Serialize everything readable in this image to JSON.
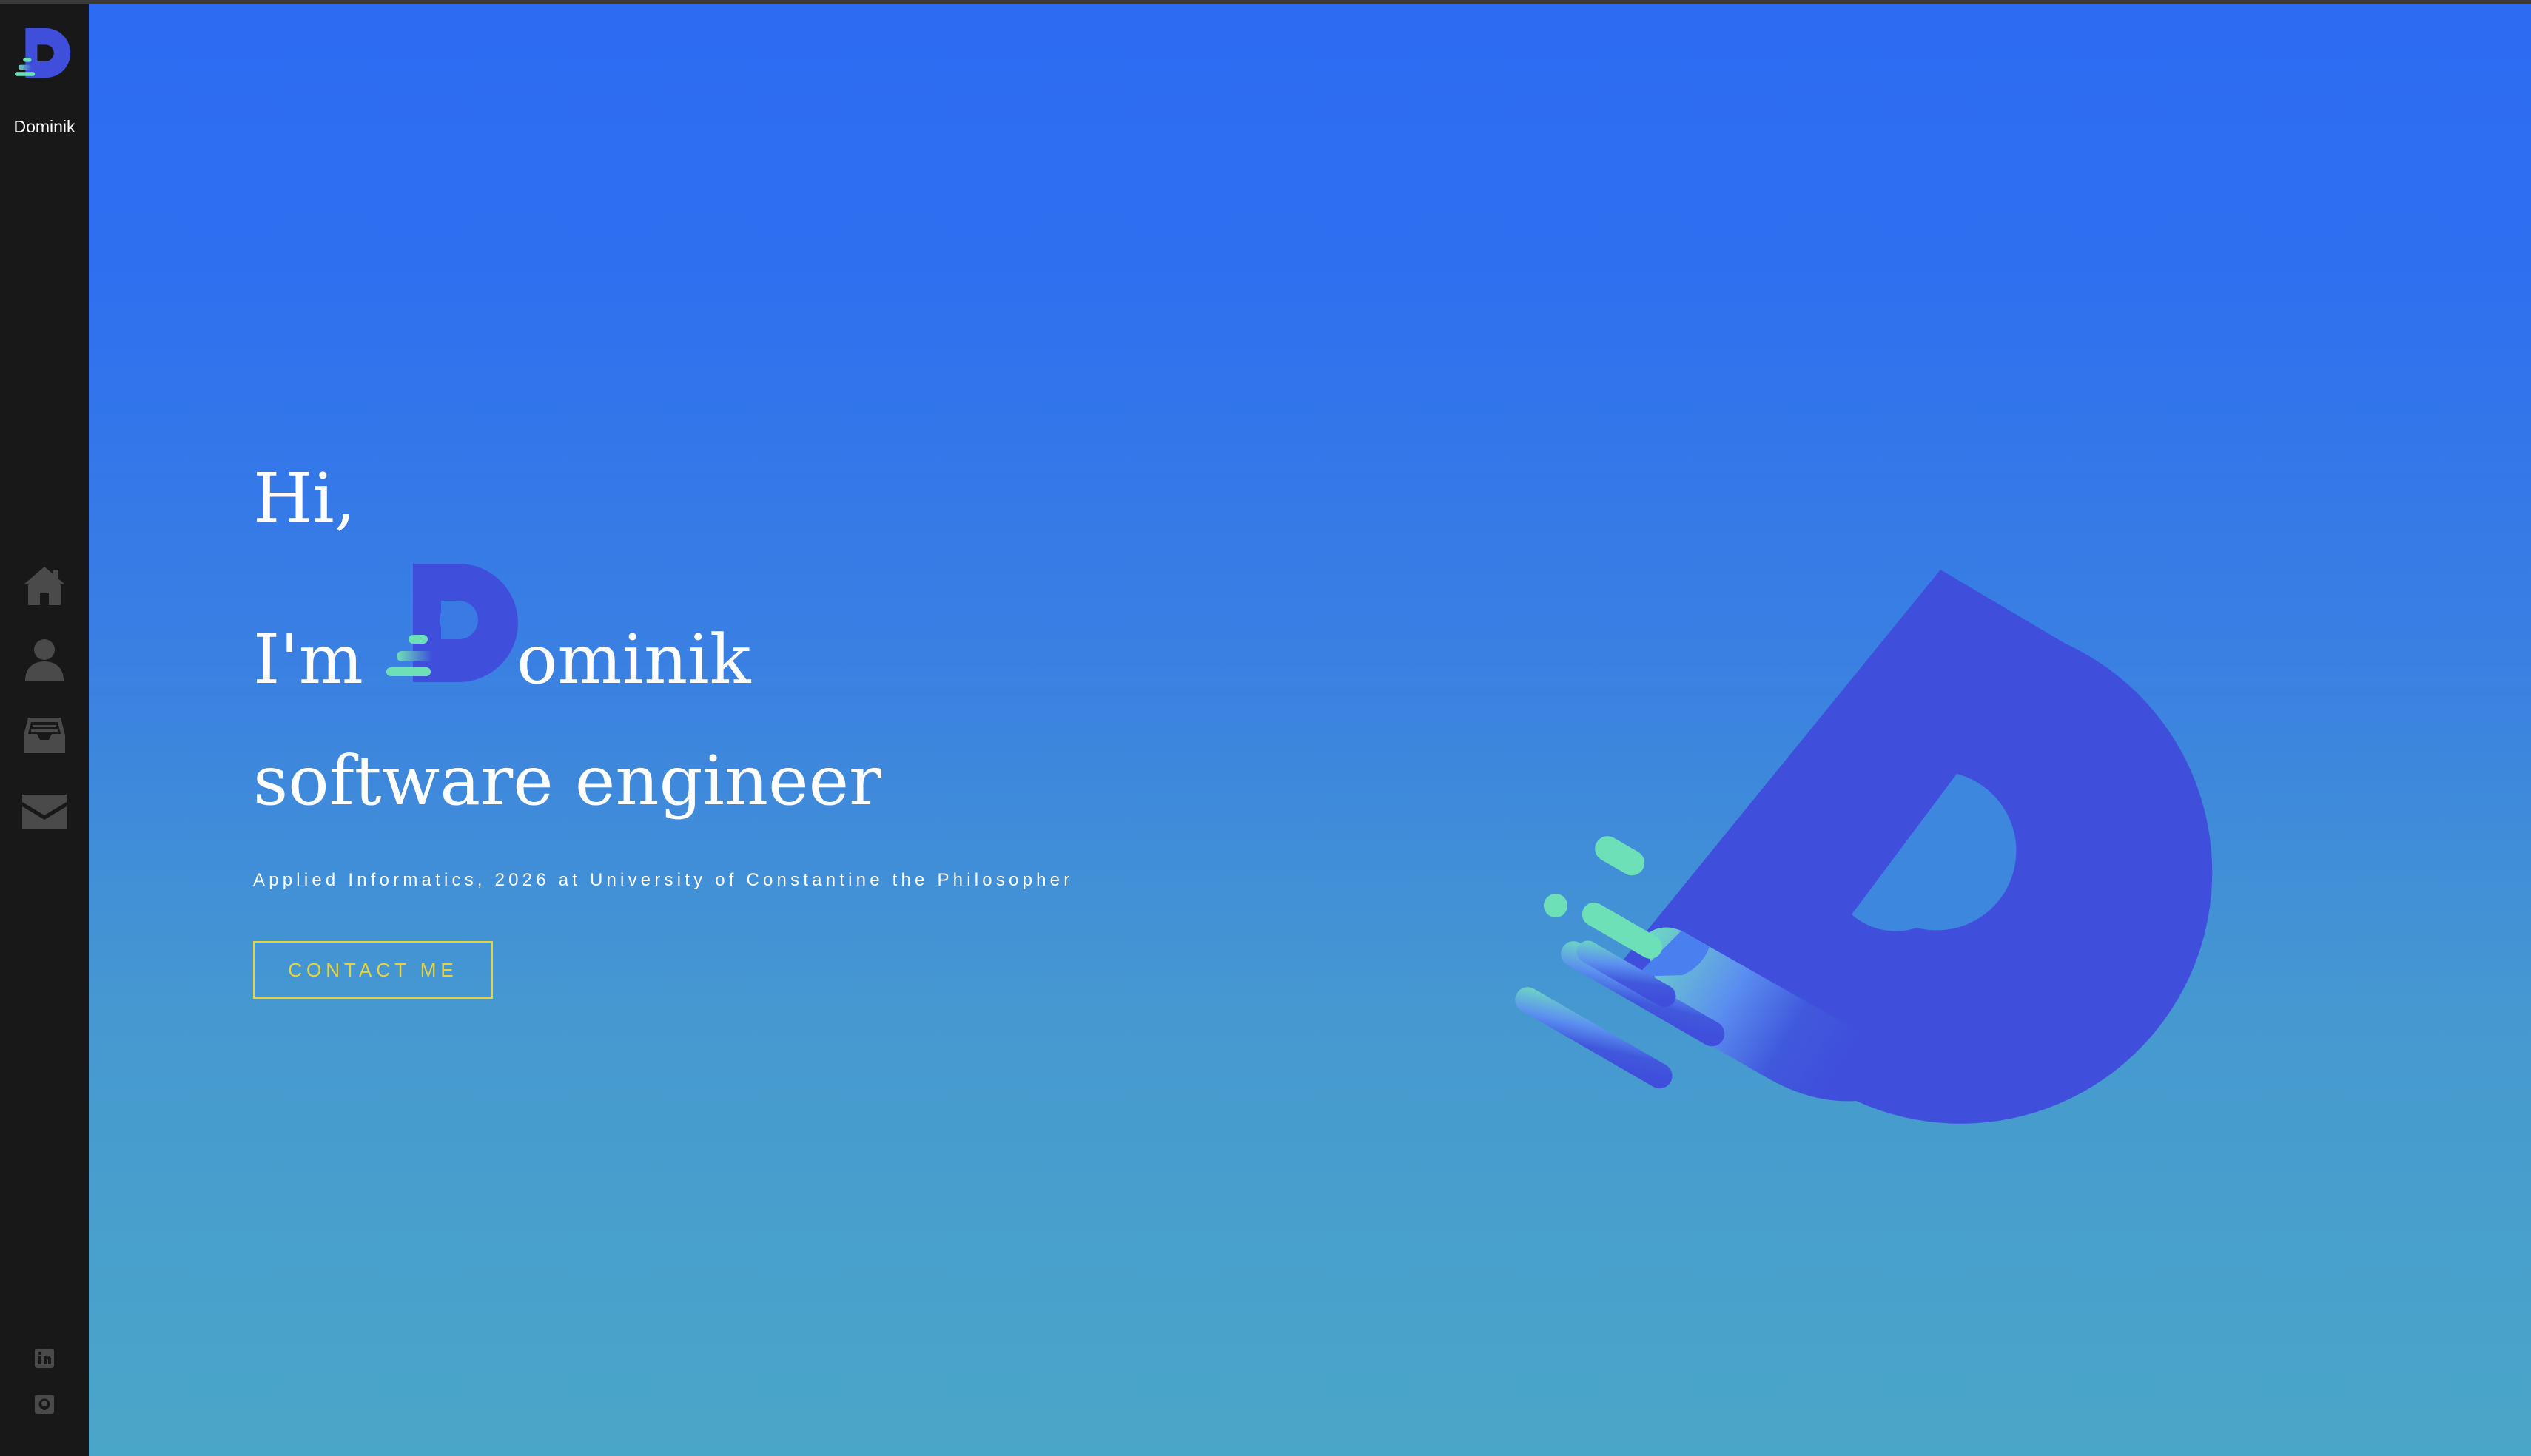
{
  "sidebar": {
    "brand_name": "Dominik",
    "nav": [
      {
        "icon": "home-icon"
      },
      {
        "icon": "user-icon"
      },
      {
        "icon": "inbox-icon"
      },
      {
        "icon": "envelope-icon"
      }
    ],
    "social": [
      {
        "icon": "linkedin-icon"
      },
      {
        "icon": "github-icon"
      }
    ]
  },
  "hero": {
    "greeting": "Hi,",
    "intro": "I'm",
    "name_rest": "ominik",
    "role": "software engineer",
    "subtitle": "Applied Informatics, 2026 at University of Constantine the Philosopher",
    "cta_label": "CONTACT ME"
  },
  "colors": {
    "sidebar_bg": "#181818",
    "gradient_top": "#2d6cf2",
    "gradient_bottom": "#4aa6c8",
    "logo_blue": "#3f4fdc",
    "logo_green": "#6ee0b8",
    "cta": "#e8d33a",
    "icon_gray": "#4a4a4a"
  }
}
